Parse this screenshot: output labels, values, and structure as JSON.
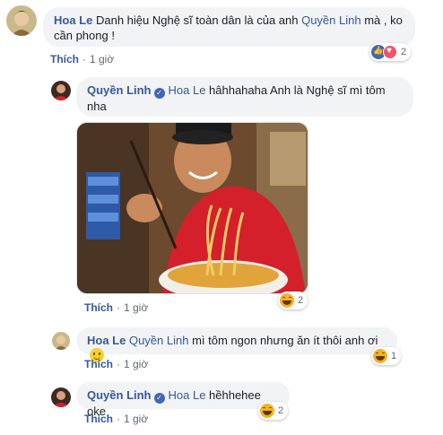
{
  "comments": [
    {
      "author": "Hoa Le",
      "text": "Danh hiệu Nghệ sĩ toàn dân là của anh ",
      "mention": "Quyền Linh",
      "text_after": " mà , ko cần phong !",
      "meta": {
        "like": "Thích",
        "time": "1 giờ"
      },
      "reactions": {
        "icons": [
          "like-icon",
          "love-icon"
        ],
        "count": "2"
      }
    },
    {
      "author": "Quyền Linh",
      "verified": true,
      "mention": "Hoa Le",
      "text": " hâhhahaha Anh là Nghệ sĩ mì tôm nha",
      "meta": {
        "like": "Thích",
        "time": "1 giờ"
      },
      "reactions": {
        "icons": [
          "haha-icon"
        ],
        "count": "2"
      }
    },
    {
      "author": "Hoa Le",
      "mention": "Quyền Linh",
      "text": " mì tôm ngon nhưng ăn ít thôi anh ơi",
      "emoji": "smiley-icon",
      "meta": {
        "like": "Thích",
        "time": "1 giờ"
      },
      "reactions": {
        "icons": [
          "haha-icon"
        ],
        "count": "1"
      }
    },
    {
      "author": "Quyền Linh",
      "verified": true,
      "mention": "Hoa Le",
      "text": " hềhhehee oke",
      "meta": {
        "like": "Thích",
        "time": "1 giờ"
      },
      "reactions": {
        "icons": [
          "haha-icon"
        ],
        "count": "2"
      }
    }
  ],
  "colors": {
    "link": "#385898",
    "bubble": "#f2f3f5",
    "meta": "#606770",
    "brand": "#4267b2"
  }
}
